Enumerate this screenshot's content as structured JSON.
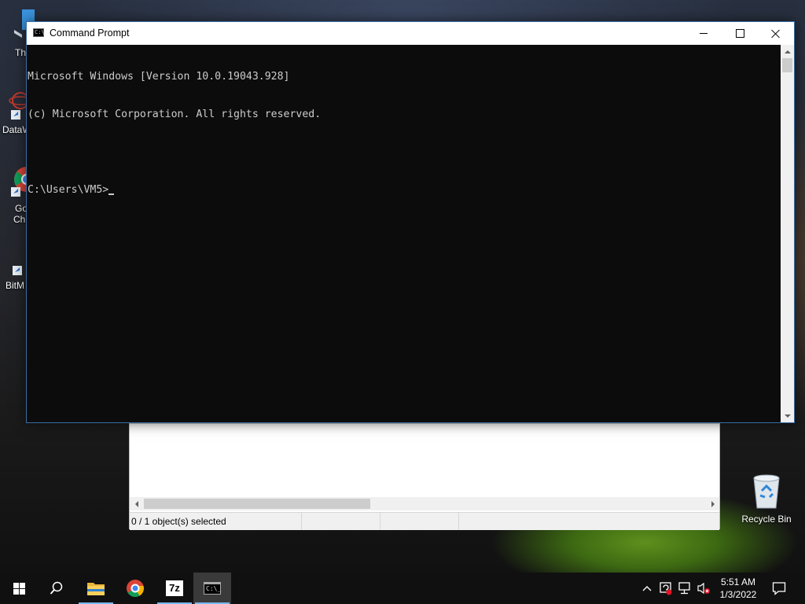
{
  "desktop": {
    "icons": [
      {
        "label": "Th",
        "name": "desktop-icon-this-pc"
      },
      {
        "label": "DataW",
        "name": "desktop-icon-dataw"
      },
      {
        "label": "Go",
        "label2": "Chi",
        "name": "desktop-icon-google-chrome"
      },
      {
        "label": "BitM",
        "name": "desktop-icon-bitm"
      },
      {
        "label": "Recycle Bin",
        "name": "desktop-icon-recycle-bin"
      }
    ]
  },
  "cmd": {
    "title": "Command Prompt",
    "app_icon_text": "C:\\",
    "lines": [
      "Microsoft Windows [Version 10.0.19043.928]",
      "(c) Microsoft Corporation. All rights reserved.",
      "",
      "C:\\Users\\VM5>"
    ],
    "colors": {
      "background": "#0c0c0c",
      "text": "#cccccc"
    }
  },
  "background_window": {
    "status_text": "0 / 1 object(s) selected"
  },
  "taskbar": {
    "items": [
      {
        "name": "start-button",
        "icon": "windows-logo-icon"
      },
      {
        "name": "search-button",
        "icon": "search-icon"
      },
      {
        "name": "taskbar-file-explorer",
        "icon": "folder-icon"
      },
      {
        "name": "taskbar-chrome",
        "icon": "chrome-icon"
      },
      {
        "name": "taskbar-7zip",
        "icon": "7zip-icon",
        "text": "7z"
      },
      {
        "name": "taskbar-command-prompt",
        "icon": "cmd-icon",
        "text": "C:\\_"
      }
    ],
    "clock": {
      "time": "5:51 AM",
      "date": "1/3/2022"
    },
    "accent_color": "#76b9ed"
  }
}
